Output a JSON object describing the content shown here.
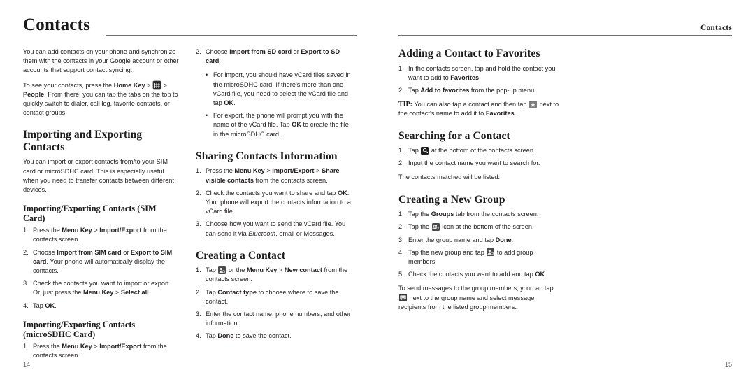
{
  "document": {
    "chapter": "Contacts",
    "running_head_right": "Contacts"
  },
  "pages": [
    {
      "number": "14",
      "columns": [
        {
          "blocks": [
            {
              "type": "paragraph",
              "id": "intro_1",
              "text": "You can add contacts on your phone and synchronize them with the contacts in your Google account or other accounts that support contact syncing."
            },
            {
              "type": "paragraph_icon",
              "id": "intro_2",
              "pre": "To see your contacts, press the ",
              "bold1": "Home Key",
              "sep1": " > ",
              "icon": "grid-icon",
              "sep2": " > ",
              "bold2": "People",
              "post": ". From there, you can tap the tabs on the top to quickly switch to dialer, call log, favorite contacts, or contact groups."
            },
            {
              "type": "heading",
              "id": "h_import_export",
              "text": "Importing and Exporting Contacts"
            },
            {
              "type": "paragraph",
              "id": "import_intro",
              "text": "You can import or export contacts from/to your SIM card or microSDHC card. This is especially useful when you need to transfer contacts between different devices."
            },
            {
              "type": "subheading",
              "id": "h_sim",
              "text": "Importing/Exporting Contacts (SIM Card)"
            },
            {
              "type": "steps",
              "id": "sim_steps",
              "items": [
                {
                  "num": "1.",
                  "text": "Press the **Menu Key** > **Import/Export** from the contacts screen."
                },
                {
                  "num": "2.",
                  "text": "Choose **Import from SIM card** or **Export to SIM card**. Your phone will automatically display the contacts."
                },
                {
                  "num": "3.",
                  "text": "Check the contacts you want to import or export. Or, just press the **Menu Key** > **Select all**."
                },
                {
                  "num": "4.",
                  "text": "Tap **OK**."
                }
              ]
            },
            {
              "type": "subheading",
              "id": "h_sdhc",
              "text": "Importing/Exporting Contacts (microSDHC Card)"
            },
            {
              "type": "steps",
              "id": "sdhc_steps",
              "items": [
                {
                  "num": "1.",
                  "text": "Press the **Menu Key** > **Import/Export** from the contacts screen."
                }
              ]
            }
          ]
        },
        {
          "blocks": [
            {
              "type": "steps",
              "id": "sdhc_steps_cont",
              "items": [
                {
                  "num": "2.",
                  "text": "Choose **Import from SD card** or **Export to SD card**."
                }
              ]
            },
            {
              "type": "bullets",
              "id": "sdhc_bullets",
              "items": [
                {
                  "text": "For import, you should have vCard files saved in the microSDHC card. If there's more than one vCard file, you need to select the vCard file and tap **OK**."
                },
                {
                  "text": "For export, the phone will prompt you with the name of the vCard file. Tap **OK** to create the file in the microSDHC card."
                }
              ]
            },
            {
              "type": "heading",
              "id": "h_sharing",
              "text": "Sharing Contacts Information"
            },
            {
              "type": "steps",
              "id": "sharing_steps",
              "items": [
                {
                  "num": "1.",
                  "text": "Press the **Menu Key** > **Import/Export** > **Share visible contacts** from the contacts screen."
                },
                {
                  "num": "2.",
                  "text": "Check the contacts you want to share and tap **OK**. Your phone will export the contacts information to a vCard file."
                },
                {
                  "num": "3.",
                  "text": "Choose how you want to send the vCard file. You can send it via __Bluetooth__, email or Messages."
                }
              ]
            },
            {
              "type": "heading",
              "id": "h_creating_contact",
              "text": "Creating a Contact"
            },
            {
              "type": "steps_icon",
              "id": "creating_contact_steps",
              "items": [
                {
                  "num": "1.",
                  "pre": "Tap ",
                  "icon": "person-add-icon",
                  "post": " or the **Menu Key** > **New contact** from the contacts screen."
                },
                {
                  "num": "2.",
                  "text": "Tap **Contact type** to choose where to save the contact."
                },
                {
                  "num": "3.",
                  "text": "Enter the contact name, phone numbers, and other information."
                },
                {
                  "num": "4.",
                  "text": "Tap **Done** to save the contact."
                }
              ]
            }
          ]
        }
      ]
    },
    {
      "number": "15",
      "columns": [
        {
          "blocks": [
            {
              "type": "heading",
              "id": "h_favorites",
              "text": "Adding a Contact to Favorites"
            },
            {
              "type": "steps",
              "id": "favorites_steps",
              "items": [
                {
                  "num": "1.",
                  "text": "In the contacts screen, tap and hold the contact you want to add to **Favorites**."
                },
                {
                  "num": "2.",
                  "text": "Tap **Add to favorites** from the pop-up menu."
                }
              ]
            },
            {
              "type": "tip",
              "id": "favorites_tip",
              "label": "TIP:",
              "pre": " You can also tap a contact and then tap ",
              "icon": "star-icon",
              "post": " next to the contact's name to add it to ",
              "bold": "Favorites",
              "tail": "."
            },
            {
              "type": "heading",
              "id": "h_searching",
              "text": "Searching for a Contact"
            },
            {
              "type": "steps_icon",
              "id": "searching_steps",
              "items": [
                {
                  "num": "1.",
                  "pre": "Tap ",
                  "icon": "search-icon",
                  "post": " at the bottom of the contacts screen."
                },
                {
                  "num": "2.",
                  "text": "Input the contact name you want to search for."
                }
              ]
            },
            {
              "type": "paragraph",
              "id": "searching_result",
              "text": "The contacts matched will be listed."
            },
            {
              "type": "heading",
              "id": "h_new_group",
              "text": "Creating a New Group"
            },
            {
              "type": "steps_icon",
              "id": "new_group_steps",
              "items": [
                {
                  "num": "1.",
                  "text": "Tap the **Groups** tab from the contacts screen."
                },
                {
                  "num": "2.",
                  "pre": "Tap the ",
                  "icon": "group-add-icon",
                  "post": " icon at the bottom of the screen."
                },
                {
                  "num": "3.",
                  "text": "Enter the group name and tap **Done**."
                },
                {
                  "num": "4.",
                  "pre": "Tap the new group and tap ",
                  "icon": "person-add-icon",
                  "post": " to add group members."
                },
                {
                  "num": "5.",
                  "text": "Check the contacts you want to add and tap **OK**."
                }
              ]
            },
            {
              "type": "paragraph_icon_lead",
              "id": "group_message_note",
              "pre": "To send messages to the group members, you can tap ",
              "icon": "message-icon",
              "post": " next to the group name and select message recipients from the listed group members."
            }
          ]
        }
      ]
    }
  ]
}
